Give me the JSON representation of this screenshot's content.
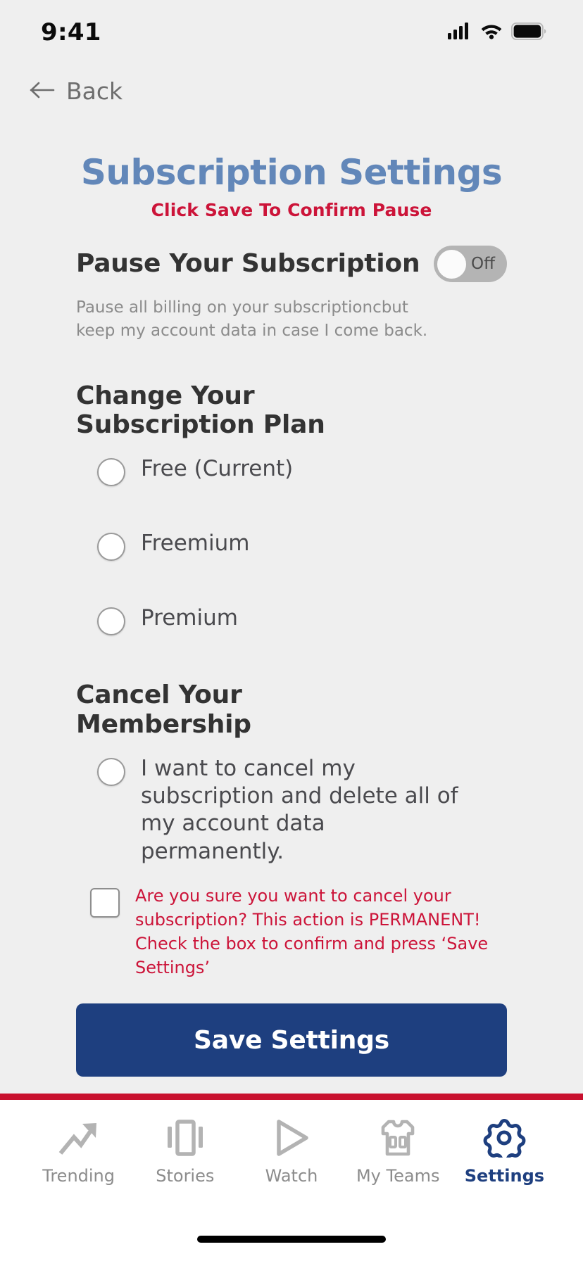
{
  "status_bar": {
    "time": "9:41",
    "icons": [
      "cellular-signal-icon",
      "wifi-icon",
      "battery-icon"
    ]
  },
  "nav": {
    "back_label": "Back",
    "back_icon": "arrow-left-icon"
  },
  "header": {
    "title": "Subscription Settings",
    "subtitle": "Click Save To Confirm Pause",
    "title_color": "#6287b9",
    "subtitle_color": "#cc1439"
  },
  "pause_section": {
    "heading": "Pause Your Subscription",
    "toggle_state_label": "Off",
    "toggle_on": false,
    "description": "Pause all billing on your subscriptioncbut keep my account data in case I come back."
  },
  "plan_section": {
    "heading": "Change Your Subscription Plan",
    "options": [
      {
        "label": "Free (Current)",
        "selected": false
      },
      {
        "label": "Freemium",
        "selected": false
      },
      {
        "label": "Premium",
        "selected": false
      }
    ]
  },
  "cancel_section": {
    "heading": "Cancel Your Membership",
    "radio_label": "I want to cancel my subscription and delete all of my account data permanently.",
    "radio_selected": false,
    "confirm_text": "Are you sure you want to cancel your subscription? This action is PERMANENT! Check the box to confirm and press  ‘Save Settings’",
    "confirm_checked": false
  },
  "actions": {
    "save_label": "Save Settings",
    "save_color": "#1e3f7f"
  },
  "tab_bar": {
    "accent_divider_color": "#c8102e",
    "active_color": "#1e3f7f",
    "inactive_color": "#8c8c8c",
    "items": [
      {
        "label": "Trending",
        "icon": "trending-arrow-icon",
        "active": false
      },
      {
        "label": "Stories",
        "icon": "stories-carousel-icon",
        "active": false
      },
      {
        "label": "Watch",
        "icon": "play-triangle-icon",
        "active": false
      },
      {
        "label": "My Teams",
        "icon": "jersey-icon",
        "active": false
      },
      {
        "label": "Settings",
        "icon": "gear-icon",
        "active": true
      }
    ]
  }
}
